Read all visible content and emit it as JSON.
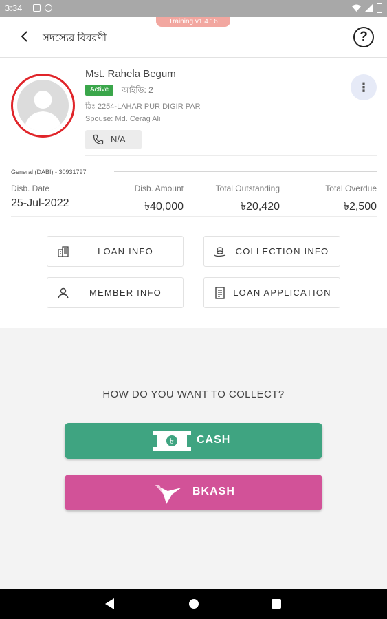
{
  "status_bar": {
    "time": "3:34"
  },
  "app_bar": {
    "title": "সদস্যের বিবরণী",
    "version": "Training v1.4.16",
    "help_symbol": "?"
  },
  "member": {
    "name": "Mst. Rahela Begum",
    "status": "Active",
    "id_text": "আইডি: 2",
    "address": "ঠিঃ 2254-LAHAR PUR  DIGIR PAR",
    "spouse": "Spouse: Md. Cerag Ali",
    "phone": "N/A",
    "more_symbol": "⋮"
  },
  "loan": {
    "type_line": "General (DABI) - 30931797",
    "stats": [
      {
        "label": "Disb. Date",
        "value": "25-Jul-2022"
      },
      {
        "label": "Disb. Amount",
        "value": "৳40,000"
      },
      {
        "label": "Total Outstanding",
        "value": "৳20,420"
      },
      {
        "label": "Total Overdue",
        "value": "৳2,500"
      }
    ]
  },
  "actions": [
    {
      "label": "LOAN INFO",
      "icon": "building-icon"
    },
    {
      "label": "COLLECTION INFO",
      "icon": "coins-icon"
    },
    {
      "label": "MEMBER INFO",
      "icon": "person-icon"
    },
    {
      "label": "LOAN APPLICATION",
      "icon": "document-icon"
    }
  ],
  "collect": {
    "title": "HOW DO YOU WANT TO COLLECT?",
    "cash_label": "CASH",
    "bkash_label": "BKASH",
    "taka_symbol": "৳"
  },
  "colors": {
    "accent_red": "#e0252a",
    "active_green": "#3aa64a",
    "cash_green": "#3fa481",
    "bkash_pink": "#d25298"
  }
}
